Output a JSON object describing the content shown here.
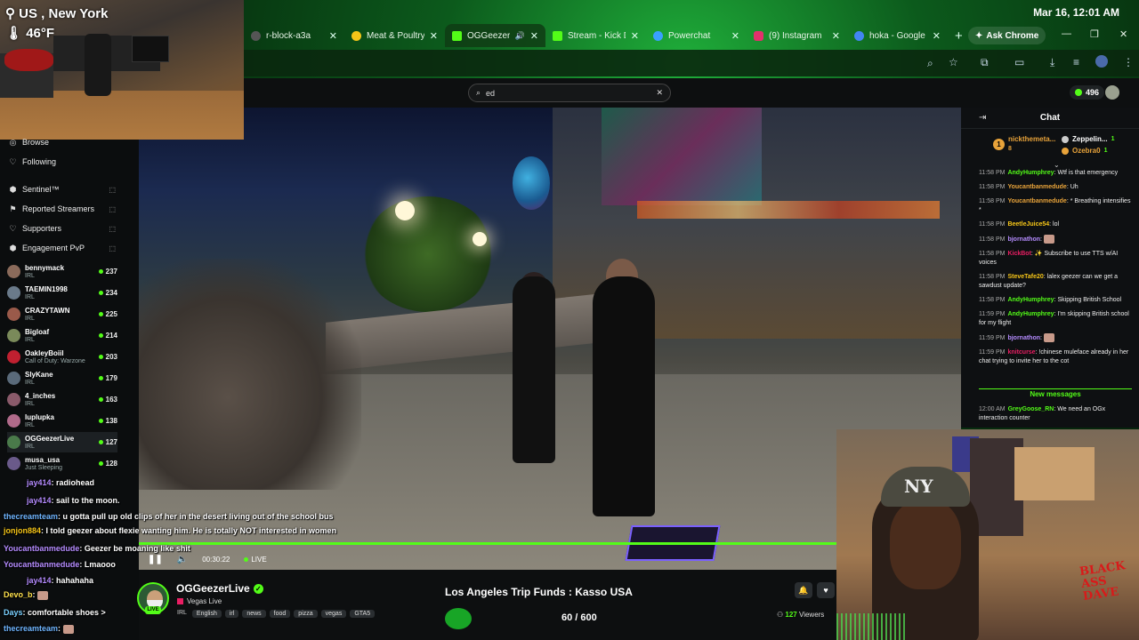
{
  "clock": "Mar 16, 12:01 AM",
  "browser": {
    "tabs": [
      {
        "label": "r-block-a3a",
        "color": "#555555",
        "active": false
      },
      {
        "label": "Meat & Poultry",
        "color": "#f5c518",
        "active": false
      },
      {
        "label": "OGGeezerLi",
        "color": "#53fc18",
        "active": true
      },
      {
        "label": "Stream - Kick D",
        "color": "#53fc18",
        "active": false
      },
      {
        "label": "Powerchat",
        "color": "#3aa0ff",
        "active": false
      },
      {
        "label": "(9) Instagram",
        "color": "#e1306c",
        "active": false
      },
      {
        "label": "hoka - Google",
        "color": "#4285f4",
        "active": false
      }
    ],
    "new_tab": "+",
    "ask_chrome": "Ask Chrome"
  },
  "search": {
    "value": "ed"
  },
  "kicks_count": "496",
  "webcam_top": {
    "location": "US , New York",
    "temperature": "46°F"
  },
  "sidebar": {
    "nav": [
      {
        "label": "Browse",
        "icon": "compass-icon"
      },
      {
        "label": "Following",
        "icon": "heart-icon"
      },
      {
        "label": "Sentinel™",
        "icon": "shield-icon"
      },
      {
        "label": "Reported Streamers",
        "icon": "flag-icon"
      },
      {
        "label": "Supporters",
        "icon": "heart-icon"
      },
      {
        "label": "Engagement PvP",
        "icon": "shield-icon"
      }
    ],
    "channels": [
      {
        "name": "bennymack",
        "category": "IRL",
        "viewers": "237",
        "color": "#8a6a5a"
      },
      {
        "name": "TAEMIN1998",
        "category": "IRL",
        "viewers": "234",
        "color": "#6a7a8a"
      },
      {
        "name": "CRAZYTAWN",
        "category": "IRL",
        "viewers": "225",
        "color": "#9a5a4a"
      },
      {
        "name": "Bigloaf",
        "category": "IRL",
        "viewers": "214",
        "color": "#7a8a5a"
      },
      {
        "name": "OakleyBoiil",
        "category": "Call of Duty: Warzone",
        "viewers": "203",
        "color": "#c02030"
      },
      {
        "name": "SlyKane",
        "category": "IRL",
        "viewers": "179",
        "color": "#5a6a7a"
      },
      {
        "name": "4_inches",
        "category": "IRL",
        "viewers": "163",
        "color": "#8a5a6a"
      },
      {
        "name": "luplupka",
        "category": "IRL",
        "viewers": "138",
        "color": "#b06a8a"
      },
      {
        "name": "OGGeezerLive",
        "category": "IRL",
        "viewers": "127",
        "color": "#4a7a4a"
      },
      {
        "name": "musa_usa",
        "category": "Just Sleeping",
        "viewers": "128",
        "color": "#6a5a8a"
      }
    ]
  },
  "overlay_chat": [
    {
      "user": "jay414",
      "text": ": radiohead",
      "color": "#b58cff"
    },
    {
      "user": "jay414",
      "text": ": sail to the moon.",
      "color": "#b58cff"
    },
    {
      "user": "thecreamteam",
      "text": ": u gotta pull up old clips of her in the desert living out of the school bus",
      "color": "#6fb5ff"
    },
    {
      "user": "jonjon884",
      "text": ": I told geezer about flexie wanting him. He is totally NOT interested in women",
      "color": "#f5c518"
    },
    {
      "user": "Youcantbanmedude",
      "text": ": Geezer be moaning like shit",
      "color": "#b58cff"
    },
    {
      "user": "Youcantbanmedude",
      "text": ": Lmaooo",
      "color": "#b58cff"
    },
    {
      "user": "jay414",
      "text": ": hahahaha",
      "color": "#b58cff"
    },
    {
      "user": "Devo_b",
      "text": ":",
      "color": "#ffe14d"
    },
    {
      "user": "Days",
      "text": ": comfortable shoes >",
      "color": "#7ad0ff"
    },
    {
      "user": "thecreamteam",
      "text": ":",
      "color": "#6fb5ff"
    }
  ],
  "player": {
    "elapsed": "00:30:22",
    "live_label": "LIVE",
    "progress": 1.0
  },
  "stream": {
    "streamer": "OGGeezerLive",
    "title": "Vegas Live",
    "live_badge": "LIVE",
    "language": "IRL",
    "tags": [
      "English",
      "irl",
      "news",
      "food",
      "pizza",
      "vegas",
      "GTA5"
    ],
    "goal_title": "Los Angeles Trip Funds : Kasso USA",
    "goal_count": "60 / 600",
    "viewers_count": "127",
    "viewers_label": "Viewers"
  },
  "chat": {
    "header": "Chat",
    "gifters": [
      {
        "name": "nickthemeta...",
        "count": "8"
      },
      {
        "name": "Zeppelin...",
        "count": "1"
      },
      {
        "name": "Ozebra0",
        "count": "1"
      }
    ],
    "messages": [
      {
        "time": "11:58 PM",
        "user": "AndyHumphrey",
        "text": ": Wtf is that emergency",
        "color": "#53fc18"
      },
      {
        "time": "11:58 PM",
        "user": "Youcantbanmedude",
        "text": ": Uh",
        "color": "#e8a33a"
      },
      {
        "time": "11:58 PM",
        "user": "Youcantbanmedude",
        "text": ": * Breathing intensifies *",
        "color": "#e8a33a"
      },
      {
        "time": "11:58 PM",
        "user": "BeetleJuice54",
        "text": ": lol",
        "color": "#f5c518"
      },
      {
        "time": "11:58 PM",
        "user": "bjornathon",
        "text": ":",
        "color": "#b58cff"
      },
      {
        "time": "11:58 PM",
        "user": "KickBot",
        "text": ": ✨ Subscribe to use TTS w/AI voices",
        "color": "#e91e63"
      },
      {
        "time": "11:58 PM",
        "user": "SteveTafe20",
        "text": ": lalex geezer can we get a sawdust update?",
        "color": "#f5c518"
      },
      {
        "time": "11:58 PM",
        "user": "AndyHumphrey",
        "text": ": Skipping British School",
        "color": "#53fc18"
      },
      {
        "time": "11:59 PM",
        "user": "AndyHumphrey",
        "text": ": I'm skipping British school for my flight",
        "color": "#53fc18"
      },
      {
        "time": "11:59 PM",
        "user": "bjornathon",
        "text": ":",
        "color": "#b58cff"
      },
      {
        "time": "11:59 PM",
        "user": "knitcurse",
        "text": ": !chinese muleface already in her chat trying to invite her to the cot",
        "color": "#e91e63"
      }
    ],
    "new_messages_label": "New messages",
    "after_new": [
      {
        "time": "12:00 AM",
        "user": "GreyGoose_RN",
        "text": ": We need an OGx interaction counter",
        "color": "#53fc18"
      }
    ]
  },
  "webcam_bottom": {
    "logo_text": "BLACK ASS DAVE"
  }
}
